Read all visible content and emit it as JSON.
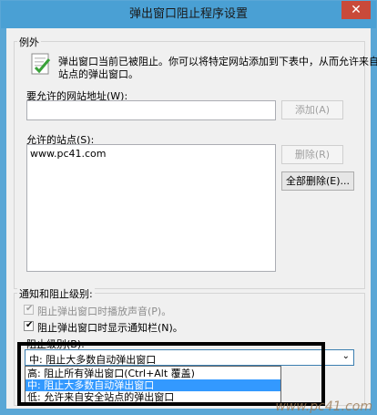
{
  "window": {
    "title": "弹出窗口阻止程序设置",
    "close_glyph": "✕"
  },
  "exceptions": {
    "group_label": "例外",
    "info_icon": "shield-check-icon",
    "info_line1": "弹出窗口当前已被阻止。你可以将特定网站添加到下表中，从而允许来自该",
    "info_line2": "站点的弹出窗口。",
    "address_label": "要允许的网站地址(W):",
    "address_value": "",
    "add_button": "添加(A)",
    "allowed_label": "允许的站点(S):",
    "allowed_sites": [
      "www.pc41.com"
    ],
    "remove_button": "删除(R)",
    "remove_all_button": "全部删除(E)..."
  },
  "notifications": {
    "group_label": "通知和阻止级别:",
    "play_sound_label": "阻止弹出窗口时播放声音(P)。",
    "play_sound_checked": true,
    "show_bar_label": "阻止弹出窗口时显示通知栏(N)。",
    "show_bar_checked": true,
    "level_label": "阻止级别(B):",
    "level_selected": "中: 阻止大多数自动弹出窗口",
    "level_options": [
      "高: 阻止所有弹出窗口(Ctrl+Alt 覆盖)",
      "中: 阻止大多数自动弹出窗口",
      "低: 允许来自安全站点的弹出窗口"
    ]
  },
  "watermark": "www.pc41.com",
  "colors": {
    "titlebar": "#4aa0d4",
    "selection": "#3399ff"
  }
}
